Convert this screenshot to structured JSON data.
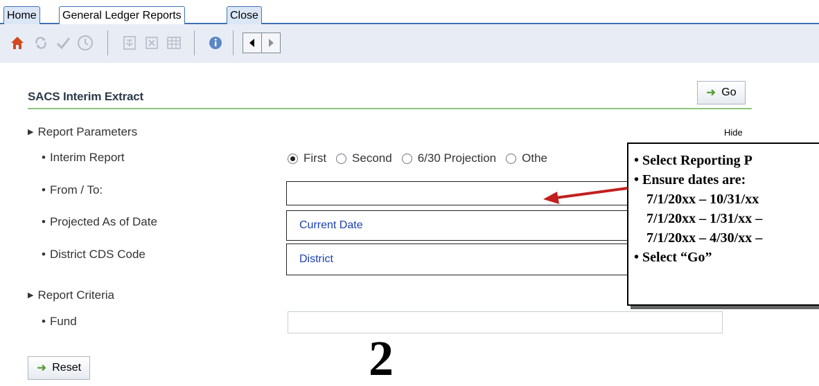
{
  "tabs": [
    {
      "label": "Home"
    },
    {
      "label": "General Ledger Reports"
    },
    {
      "label": "Close"
    }
  ],
  "toolbar_icons": [
    "home-icon",
    "refresh-icon",
    "check-icon",
    "clock-icon",
    "pdf-icon",
    "excel-icon",
    "grid-icon",
    "info-icon",
    "prev-arrow-icon",
    "next-arrow-icon"
  ],
  "page": {
    "title": "SACS Interim Extract",
    "go_label": "Go",
    "hide_label": "Hide",
    "reset_label": "Reset"
  },
  "report_parameters": {
    "heading": "Report Parameters",
    "interim_report_label": "Interim Report",
    "options": [
      "First",
      "Second",
      "6/30 Projection",
      "Othe"
    ],
    "selected": "First",
    "from_to_label": "From / To:",
    "from_to_value": "",
    "projected_label": "Projected As of Date",
    "projected_value": "Current Date",
    "cds_label": "District CDS Code",
    "cds_value": "District"
  },
  "report_criteria": {
    "heading": "Report Criteria",
    "fund_label": "Fund",
    "fund_value": ""
  },
  "annotation": {
    "step_number": "2",
    "lines": [
      "Select Reporting P",
      "Ensure dates are:",
      "7/1/20xx – 10/31/xx",
      "7/1/20xx – 1/31/xx –",
      "7/1/20xx – 4/30/xx –",
      "Select “Go”"
    ]
  },
  "colors": {
    "tab_border": "#3f71b6",
    "toolbar_bg": "#e8edf5",
    "title_rule": "#8ec47a",
    "field_text": "#1a3fb5",
    "callout_arrow": "#c0201f",
    "go_arrow": "#4f9a2e"
  }
}
